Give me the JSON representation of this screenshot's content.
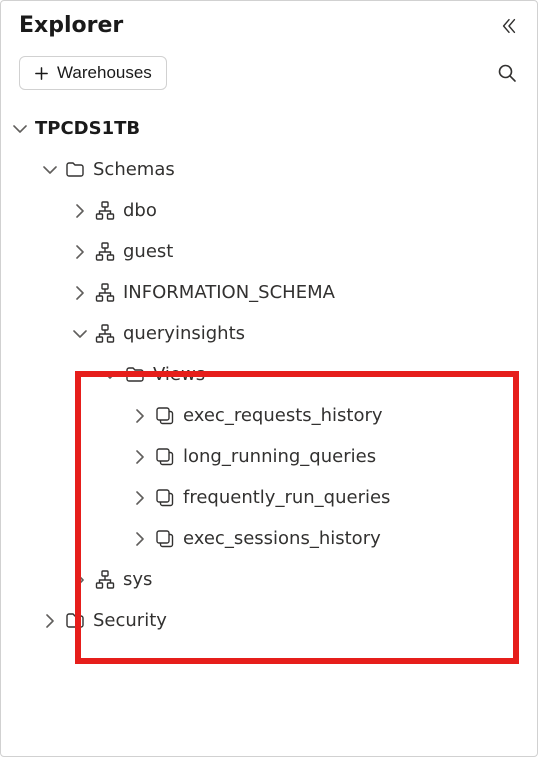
{
  "panel": {
    "title": "Explorer",
    "add_button_label": "Warehouses"
  },
  "tree": {
    "database": {
      "label": "TPCDS1TB",
      "expanded": true
    },
    "schemas_folder": {
      "label": "Schemas",
      "expanded": true
    },
    "schemas": {
      "dbo": {
        "label": "dbo"
      },
      "guest": {
        "label": "guest"
      },
      "information_schema": {
        "label": "INFORMATION_SCHEMA"
      },
      "queryinsights": {
        "label": "queryinsights",
        "expanded": true
      },
      "sys": {
        "label": "sys"
      }
    },
    "views_folder": {
      "label": "Views",
      "expanded": true
    },
    "views": {
      "exec_requests_history": {
        "label": "exec_requests_history"
      },
      "long_running_queries": {
        "label": "long_running_queries"
      },
      "frequently_run_queries": {
        "label": "frequently_run_queries"
      },
      "exec_sessions_history": {
        "label": "exec_sessions_history"
      }
    },
    "security_folder": {
      "label": "Security"
    }
  }
}
